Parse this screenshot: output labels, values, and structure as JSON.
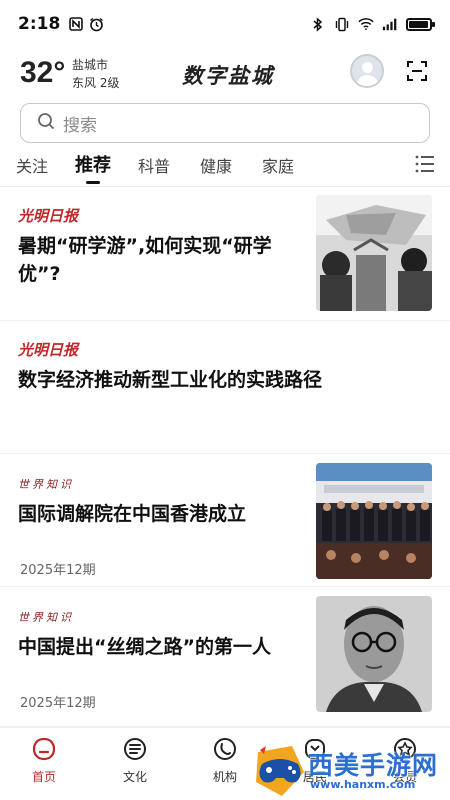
{
  "status_bar": {
    "time": "2:18"
  },
  "header": {
    "temperature": "32°",
    "city": "盐城市",
    "wind": "东风  2级",
    "brand": "数字盐城"
  },
  "search": {
    "placeholder": "搜索"
  },
  "tabs": [
    {
      "label": "关注"
    },
    {
      "label": "推荐",
      "active": true
    },
    {
      "label": "科普"
    },
    {
      "label": "健康"
    },
    {
      "label": "家庭"
    }
  ],
  "feed": [
    {
      "source": "光明日报",
      "title_lines": [
        "暑期“研学游”,如何实现“研学",
        "优”?"
      ]
    },
    {
      "source": "光明日报",
      "title_lines": [
        "数字经济推动新型工业化的实践路径"
      ]
    },
    {
      "source": "世界知识",
      "title_lines": [
        "国际调解院在中国香港成立"
      ],
      "meta": "2025年12期"
    },
    {
      "source": "世界知识",
      "title_lines": [
        "中国提出“丝绸之路”的第一人"
      ],
      "meta": "2025年12期"
    }
  ],
  "bottom_nav": [
    {
      "label": "首页",
      "icon": "home-icon",
      "active": true
    },
    {
      "label": "文化",
      "icon": "culture-icon"
    },
    {
      "label": "机构",
      "icon": "organization-icon"
    },
    {
      "label": "居民",
      "icon": "resident-icon"
    },
    {
      "label": "会员",
      "icon": "member-icon"
    }
  ],
  "watermark": {
    "text": "西美手游网",
    "url": "www.hanxm.com"
  },
  "colors": {
    "accent": "#c0292b",
    "watermark": "#2a6fd1"
  }
}
